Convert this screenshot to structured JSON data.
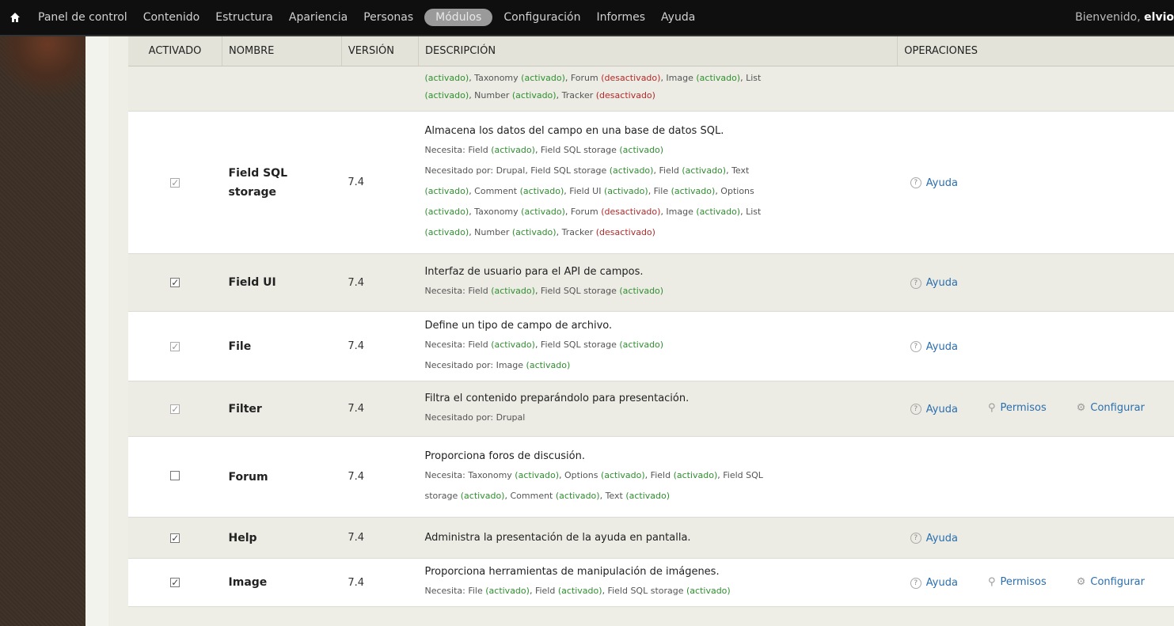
{
  "toolbar": {
    "items": [
      {
        "label": "Panel de control"
      },
      {
        "label": "Contenido"
      },
      {
        "label": "Estructura"
      },
      {
        "label": "Apariencia"
      },
      {
        "label": "Personas"
      },
      {
        "label": "Módulos",
        "active": true
      },
      {
        "label": "Configuración"
      },
      {
        "label": "Informes"
      },
      {
        "label": "Ayuda"
      }
    ],
    "welcome_prefix": "Bienvenido,",
    "welcome_user": "elvio"
  },
  "table": {
    "headers": {
      "enabled": "ACTIVADO",
      "name": "NOMBRE",
      "version": "VERSIÓN",
      "description": "DESCRIPCIÓN",
      "operations": "OPERACIONES"
    }
  },
  "labels": {
    "activated": "(activado)",
    "deactivated": "(desactivado)",
    "help": "Ayuda",
    "permissions": "Permisos",
    "configure": "Configurar"
  },
  "modules": [
    {
      "partial": true,
      "lines": [
        "(activado), Taxonomy (activado), Forum (desactivado), Image (activado), List",
        "(activado), Number (activado), Tracker (desactivado)"
      ]
    },
    {
      "name": "Field SQL storage",
      "checked": true,
      "dim": true,
      "version": "7.4",
      "description": "Almacena los datos del campo en una base de datos SQL.",
      "requires": "Necesita: Field (activado), Field SQL storage (activado)",
      "required_by_lines": [
        "Necesitado por: Drupal, Field SQL storage (activado), Field (activado), Text",
        "(activado), Comment (activado), Field UI (activado), File (activado), Options",
        "(activado), Taxonomy (activado), Forum (desactivado), Image (activado), List",
        "(activado), Number (activado), Tracker (desactivado)"
      ],
      "ops": [
        "help"
      ]
    },
    {
      "name": "Field UI",
      "checked": true,
      "dim": false,
      "version": "7.4",
      "description": "Interfaz de usuario para el API de campos.",
      "requires": "Necesita: Field (activado), Field SQL storage (activado)",
      "ops": [
        "help"
      ]
    },
    {
      "name": "File",
      "checked": true,
      "dim": true,
      "version": "7.4",
      "description": "Define un tipo de campo de archivo.",
      "requires": "Necesita: Field (activado), Field SQL storage (activado)",
      "required_by_lines": [
        "Necesitado por: Image (activado)"
      ],
      "ops": [
        "help"
      ]
    },
    {
      "name": "Filter",
      "checked": true,
      "dim": true,
      "version": "7.4",
      "description": "Filtra el contenido preparándolo para presentación.",
      "required_by_lines": [
        "Necesitado por: Drupal"
      ],
      "ops": [
        "help",
        "permissions",
        "configure"
      ]
    },
    {
      "name": "Forum",
      "checked": false,
      "dim": false,
      "version": "7.4",
      "description": "Proporciona foros de discusión.",
      "requires_lines": [
        "Necesita: Taxonomy (activado), Options (activado), Field (activado), Field SQL",
        "storage (activado), Comment (activado), Text (activado)"
      ],
      "ops": []
    },
    {
      "name": "Help",
      "checked": true,
      "dim": false,
      "version": "7.4",
      "description": "Administra la presentación de la ayuda en pantalla.",
      "ops": [
        "help"
      ]
    },
    {
      "name": "Image",
      "checked": true,
      "dim": false,
      "version": "7.4",
      "description": "Proporciona herramientas de manipulación de imágenes.",
      "requires": "Necesita: File (activado), Field (activado), Field SQL storage (activado)",
      "ops": [
        "help",
        "permissions",
        "configure"
      ]
    }
  ]
}
